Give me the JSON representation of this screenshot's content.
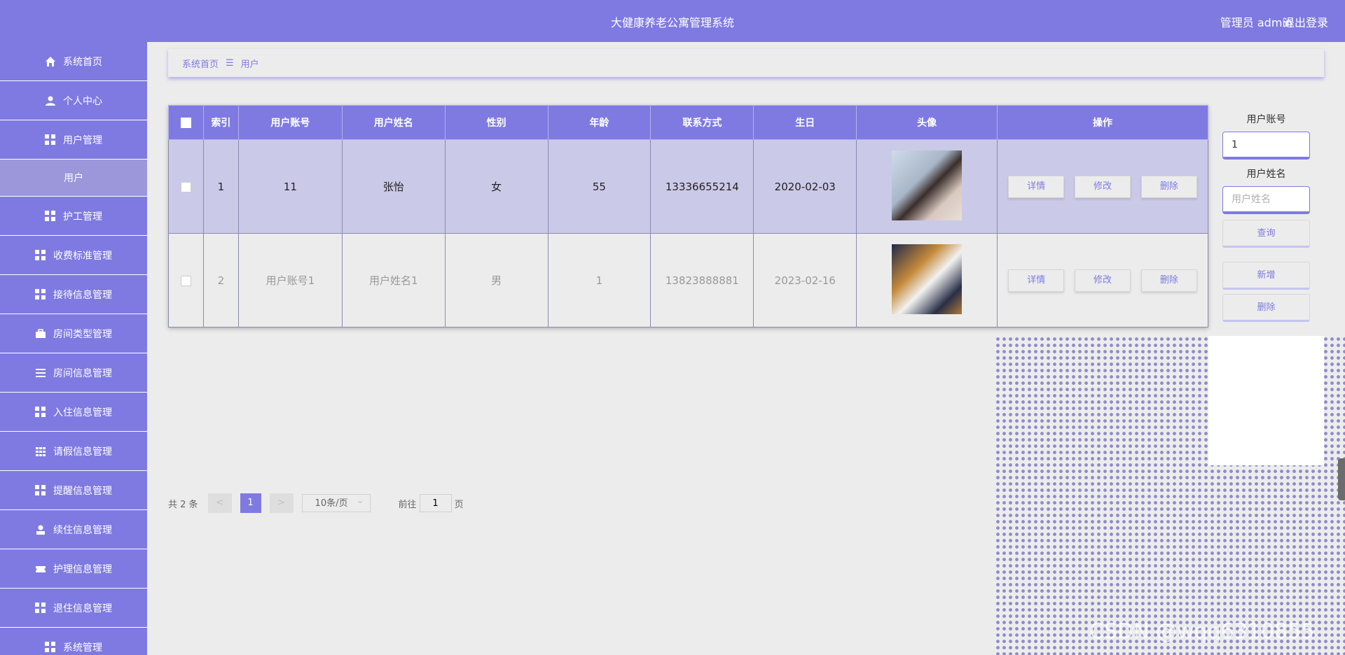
{
  "header": {
    "title": "大健康养老公寓管理系统",
    "user": "管理员 admin",
    "logout": "退出登录"
  },
  "sidebar": {
    "items": [
      {
        "label": "系统首页"
      },
      {
        "label": "个人中心"
      },
      {
        "label": "用户管理"
      },
      {
        "label": "用户"
      },
      {
        "label": "护工管理"
      },
      {
        "label": "收费标准管理"
      },
      {
        "label": "接待信息管理"
      },
      {
        "label": "房间类型管理"
      },
      {
        "label": "房间信息管理"
      },
      {
        "label": "入住信息管理"
      },
      {
        "label": "请假信息管理"
      },
      {
        "label": "提醒信息管理"
      },
      {
        "label": "续住信息管理"
      },
      {
        "label": "护理信息管理"
      },
      {
        "label": "退住信息管理"
      },
      {
        "label": "系统管理"
      }
    ]
  },
  "breadcrumb": {
    "home": "系统首页",
    "separator": "☰",
    "current": "用户"
  },
  "table": {
    "columns": [
      "索引",
      "用户账号",
      "用户姓名",
      "性别",
      "年龄",
      "联系方式",
      "生日",
      "头像",
      "操作"
    ],
    "rows": [
      {
        "index": "1",
        "account": "11",
        "name": "张怡",
        "gender": "女",
        "age": "55",
        "phone": "13336655214",
        "birthday": "2020-02-03"
      },
      {
        "index": "2",
        "account": "用户账号1",
        "name": "用户姓名1",
        "gender": "男",
        "age": "1",
        "phone": "13823888881",
        "birthday": "2023-02-16"
      }
    ],
    "actions": {
      "detail": "详情",
      "edit": "修改",
      "delete": "删除"
    }
  },
  "search": {
    "account_label": "用户账号",
    "account_value": "1",
    "name_label": "用户姓名",
    "name_placeholder": "用户姓名",
    "query": "查询",
    "add": "新增",
    "delete": "删除"
  },
  "pagination": {
    "total": "共 2 条",
    "prev": "<",
    "page": "1",
    "next": ">",
    "page_size": "10条/页",
    "goto": "前往",
    "goto_value": "1",
    "page_unit": "页"
  },
  "watermark": "CSDN @wqq6310855",
  "colors": {
    "accent": "#7f7ae1",
    "highlight_row": "#cbc9e8",
    "background": "#ececec"
  }
}
